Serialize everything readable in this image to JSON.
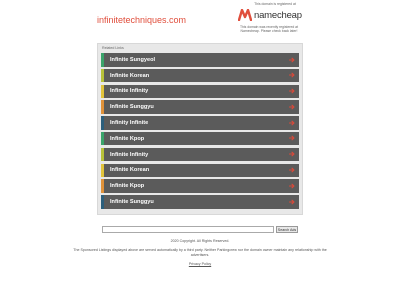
{
  "header": {
    "domain": "infinitetechniques.com",
    "notice_top": "This domain is registered at",
    "logo_text": "namecheap",
    "notice_bottom": "This domain was recently registered at Namecheap. Please check back later!"
  },
  "colors": {
    "accent": "#e04e3c",
    "link_bg": "#5b5b5b",
    "arrow": "#d94a3a"
  },
  "related": {
    "title": "Related Links",
    "links": [
      {
        "label": "Infinite Sungyeol",
        "stripe": "#3aa46b"
      },
      {
        "label": "Infinite Korean",
        "stripe": "#b8c23a"
      },
      {
        "label": "Infinite Infinity",
        "stripe": "#e2c43b"
      },
      {
        "label": "Infinite Sunggyu",
        "stripe": "#e0923a"
      },
      {
        "label": "Infinity Infinite",
        "stripe": "#2c5f7c"
      },
      {
        "label": "Infinite Kpop",
        "stripe": "#3aa46b"
      },
      {
        "label": "Infinite Infinity",
        "stripe": "#b8c23a"
      },
      {
        "label": "Infinite Korean",
        "stripe": "#e2c43b"
      },
      {
        "label": "Infinite Kpop",
        "stripe": "#e0923a"
      },
      {
        "label": "Infinite Sunggyu",
        "stripe": "#2c5f7c"
      }
    ],
    "arrow_icon": "arrow-right-icon"
  },
  "search": {
    "value": "",
    "button_label": "Search Ads"
  },
  "footer": {
    "copyright": "2020 Copyright. All Rights Reserved.",
    "disclaimer": "The Sponsored Listings displayed above are served automatically by a third party. Neither Parkingcrew nor the domain owner maintain any relationship with the advertisers.",
    "privacy": "Privacy Policy"
  }
}
